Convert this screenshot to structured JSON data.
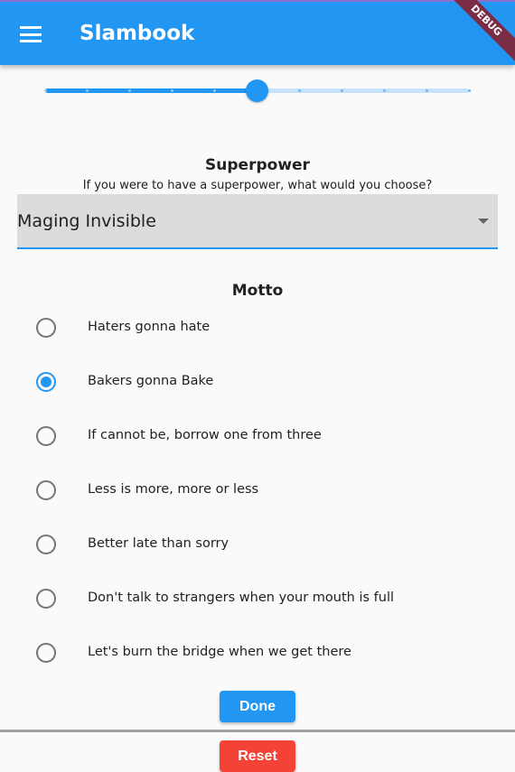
{
  "appbar": {
    "title": "Slambook",
    "debug_banner": "DEBUG",
    "menu_icon": "hamburger-menu-icon"
  },
  "slider": {
    "min": 0,
    "max": 10,
    "divisions": 10,
    "value": 5,
    "active_color": "#2196f3",
    "inactive_color": "#c6e2fb"
  },
  "superpower": {
    "heading": "Superpower",
    "question": "If you were to have a superpower, what would you choose?",
    "selected": "Maging Invisible"
  },
  "motto": {
    "heading": "Motto",
    "selected_index": 1,
    "options": [
      "Haters gonna hate",
      "Bakers gonna Bake",
      "If cannot be, borrow one from three",
      "Less is more, more or less",
      "Better late than sorry",
      "Don't talk to strangers when your mouth is full",
      "Let's burn the bridge when we get there"
    ]
  },
  "buttons": {
    "done": "Done",
    "reset": "Reset",
    "done_color": "#2196f3",
    "reset_color": "#f44336"
  }
}
